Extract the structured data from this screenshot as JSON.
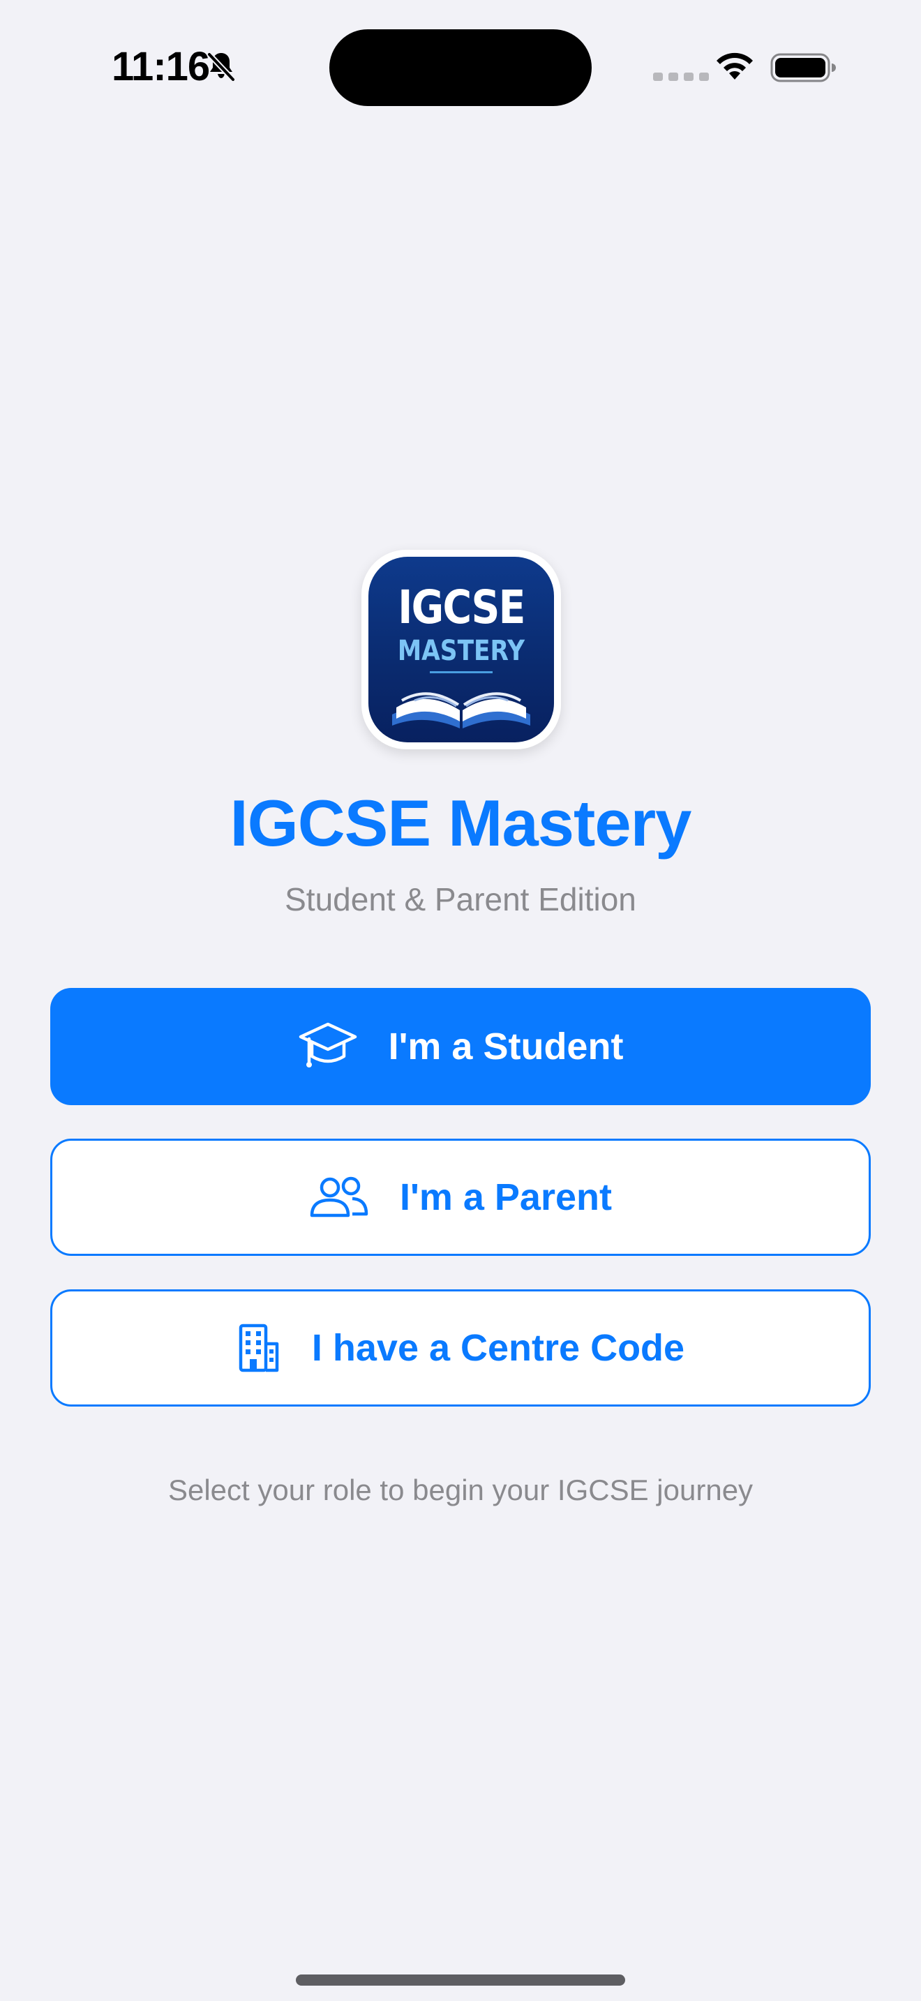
{
  "status_bar": {
    "time": "11:16"
  },
  "logo": {
    "line1": "IGCSE",
    "line2": "MASTERY"
  },
  "header": {
    "title": "IGCSE Mastery",
    "subtitle": "Student & Parent Edition"
  },
  "buttons": {
    "student": "I'm a Student",
    "parent": "I'm a Parent",
    "centre": "I have a Centre Code"
  },
  "footer": {
    "hint": "Select your role to begin your IGCSE journey"
  },
  "colors": {
    "accent": "#0A7AFF",
    "background": "#F2F2F7",
    "secondary_text": "#8A8A8E",
    "logo_navy": "#0A2A6E"
  },
  "icons": {
    "status": [
      "bell-slash-icon",
      "wifi-icon",
      "battery-icon"
    ],
    "student": "graduation-cap-icon",
    "parent": "people-icon",
    "centre": "building-icon"
  }
}
